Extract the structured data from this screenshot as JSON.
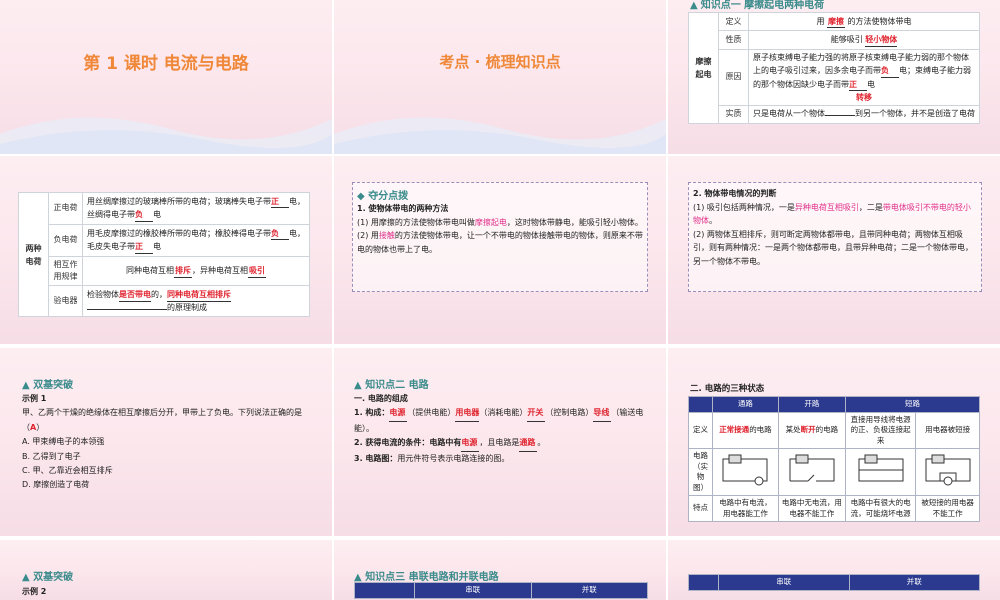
{
  "s1": {
    "title": "第 1 课时  电流与电路"
  },
  "s2": {
    "title": "考点 · 梳理知识点"
  },
  "s3": {
    "head": "知识点一  摩擦起电两种电荷",
    "group": "摩擦起电",
    "rows": [
      {
        "label": "定义",
        "pre": "用",
        "ans": "摩擦",
        "post": "的方法使物体带电"
      },
      {
        "label": "性质",
        "pre": "能够吸引",
        "ans": "轻小物体",
        "post": ""
      },
      {
        "label": "原因",
        "text": "原子核束缚电子能力强的将原子核束缚电子能力弱的那个物体上的电子吸引过来，因多余电子而带",
        "ans1": "负",
        "mid": "电；束缚电子能力弱的那个物体因缺少电子而带",
        "ans2": "正",
        "post": "电",
        "ans3": "转移"
      },
      {
        "label": "实质",
        "text": "只是电荷从一个物体",
        "post": "到另一个物体，并不是创造了电荷"
      }
    ]
  },
  "s4": {
    "group": "两种电荷",
    "rows": [
      {
        "label": "正电荷",
        "text": "用丝绸摩擦过的玻璃棒所带的电荷；玻璃棒失电子带",
        "ans1": "正",
        "mid": "电，丝绸得电子带",
        "ans2": "负",
        "post": "电"
      },
      {
        "label": "负电荷",
        "text": "用毛皮摩擦过的橡胶棒所带的电荷；橡胶棒得电子带",
        "ans1": "负",
        "mid": "电，毛皮失电子带",
        "ans2": "正",
        "post": "电"
      },
      {
        "label": "相互作用规律",
        "pre": "同种电荷互相",
        "ans1": "排斥",
        "mid": "，异种电荷互相",
        "ans2": "吸引"
      },
      {
        "label": "验电器",
        "pre": "检验物体",
        "ans1": "是否带电",
        "mid": "的，",
        "ans2": "同种电荷互相排斥",
        "post": "的原理制成"
      }
    ]
  },
  "s5": {
    "head": "夺分点拨",
    "p1": "1. 使物体带电的两种方法",
    "p2a": "(1) 用摩擦的方法使物体带电叫做",
    "p2b": "摩擦起电",
    "p2c": "，这时物体带静电，能吸引轻小物体。",
    "p3a": "(2) 用",
    "p3b": "接触",
    "p3c": "的方法使物体带电，让一个不带电的物体接触带电的物体，则原来不带电的物体也带上了电。"
  },
  "s6": {
    "p1": "2. 物体带电情况的判断",
    "p2a": "(1) 吸引包括两种情况，一是",
    "p2b": "异种电荷互相吸引",
    "p2c": "，二是",
    "p2d": "带电体吸引不带电的轻小物体",
    "p2e": "。",
    "p3": "(2) 两物体互相排斥，则可断定两物体都带电，且带同种电荷；两物体互相吸引，则有两种情况：一是两个物体都带电，且带异种电荷；二是一个物体带电，另一个物体不带电。"
  },
  "s7": {
    "head": "双基突破",
    "ex": "示例 1",
    "q": "甲、乙两个干燥的绝缘体在相互摩擦后分开，甲带上了负电。下列说法正确的是（",
    "ans": "A",
    "q2": "）",
    "opts": [
      "A. 甲束缚电子的本领强",
      "B. 乙得到了电子",
      "C. 甲、乙靠近会相互排斥",
      "D. 摩擦创造了电荷"
    ]
  },
  "s8": {
    "head": "知识点二  电路",
    "sub": "一. 电路的组成",
    "l1a": "1. 构成：",
    "l1b": "电源",
    "l1c": "（提供电能）",
    "l1d": "用电器",
    "l1e": "（消耗电能）",
    "l1f": "开关",
    "l1g": "（控制电路）",
    "l1h": "导线",
    "l1i": "（输送电能）。",
    "l2a": "2. 获得电流的条件：电路中有",
    "l2b": "电源",
    "l2c": "，且电路是",
    "l2d": "通路",
    "l2e": "。",
    "l3a": "3. 电路图：",
    "l3b": "用元件符号表示电路连接的图。"
  },
  "s9": {
    "sub": "二. 电路的三种状态",
    "headers": [
      "",
      "通路",
      "开路",
      "短路",
      ""
    ],
    "def_label": "定义",
    "def": [
      "正常接通的电路",
      "某处断开的电路",
      "直接用导线将电源的正、负极连接起来",
      "用电器被短接"
    ],
    "def_ans": [
      "正常接通",
      "断开"
    ],
    "pic_label": "电路（实物图）",
    "feat_label": "特点",
    "feat": [
      "电路中有电流，用电器能工作",
      "电路中无电流，用电器不能工作",
      "电路中有很大的电流，可能烧坏电源",
      "被短接的用电器不能工作"
    ]
  },
  "s10": {
    "head": "双基突破",
    "ex": "示例 2"
  },
  "s11": {
    "head": "知识点三  串联电路和并联电路",
    "cols": [
      "串联",
      "并联"
    ]
  },
  "s12": {
    "cols": [
      "串联",
      "并联"
    ]
  }
}
